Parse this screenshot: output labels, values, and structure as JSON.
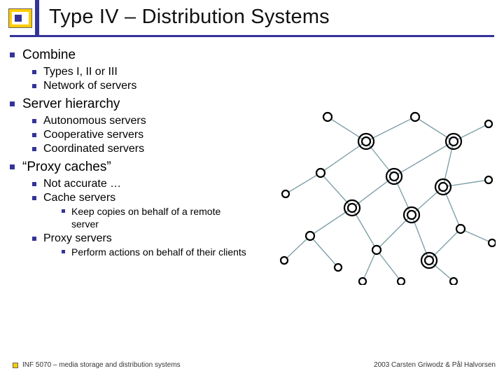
{
  "title": "Type IV – Distribution Systems",
  "bullets": [
    {
      "text": "Combine",
      "children": [
        {
          "text": "Types I, II or III"
        },
        {
          "text": "Network of servers"
        }
      ]
    },
    {
      "text": "Server hierarchy",
      "children": [
        {
          "text": "Autonomous servers"
        },
        {
          "text": "Cooperative servers"
        },
        {
          "text": "Coordinated servers"
        }
      ]
    },
    {
      "text": "“Proxy caches”",
      "children": [
        {
          "text": "Not accurate …"
        },
        {
          "text": "Cache servers",
          "children": [
            {
              "text": "Keep copies on behalf of a remote server"
            }
          ]
        },
        {
          "text": "Proxy servers",
          "children": [
            {
              "text": "Perform actions on behalf of their clients"
            }
          ]
        }
      ]
    }
  ],
  "footer": {
    "left": "INF 5070 – media storage and distribution systems",
    "right": "2003  Carsten Griwodz & Pål Halvorsen"
  }
}
